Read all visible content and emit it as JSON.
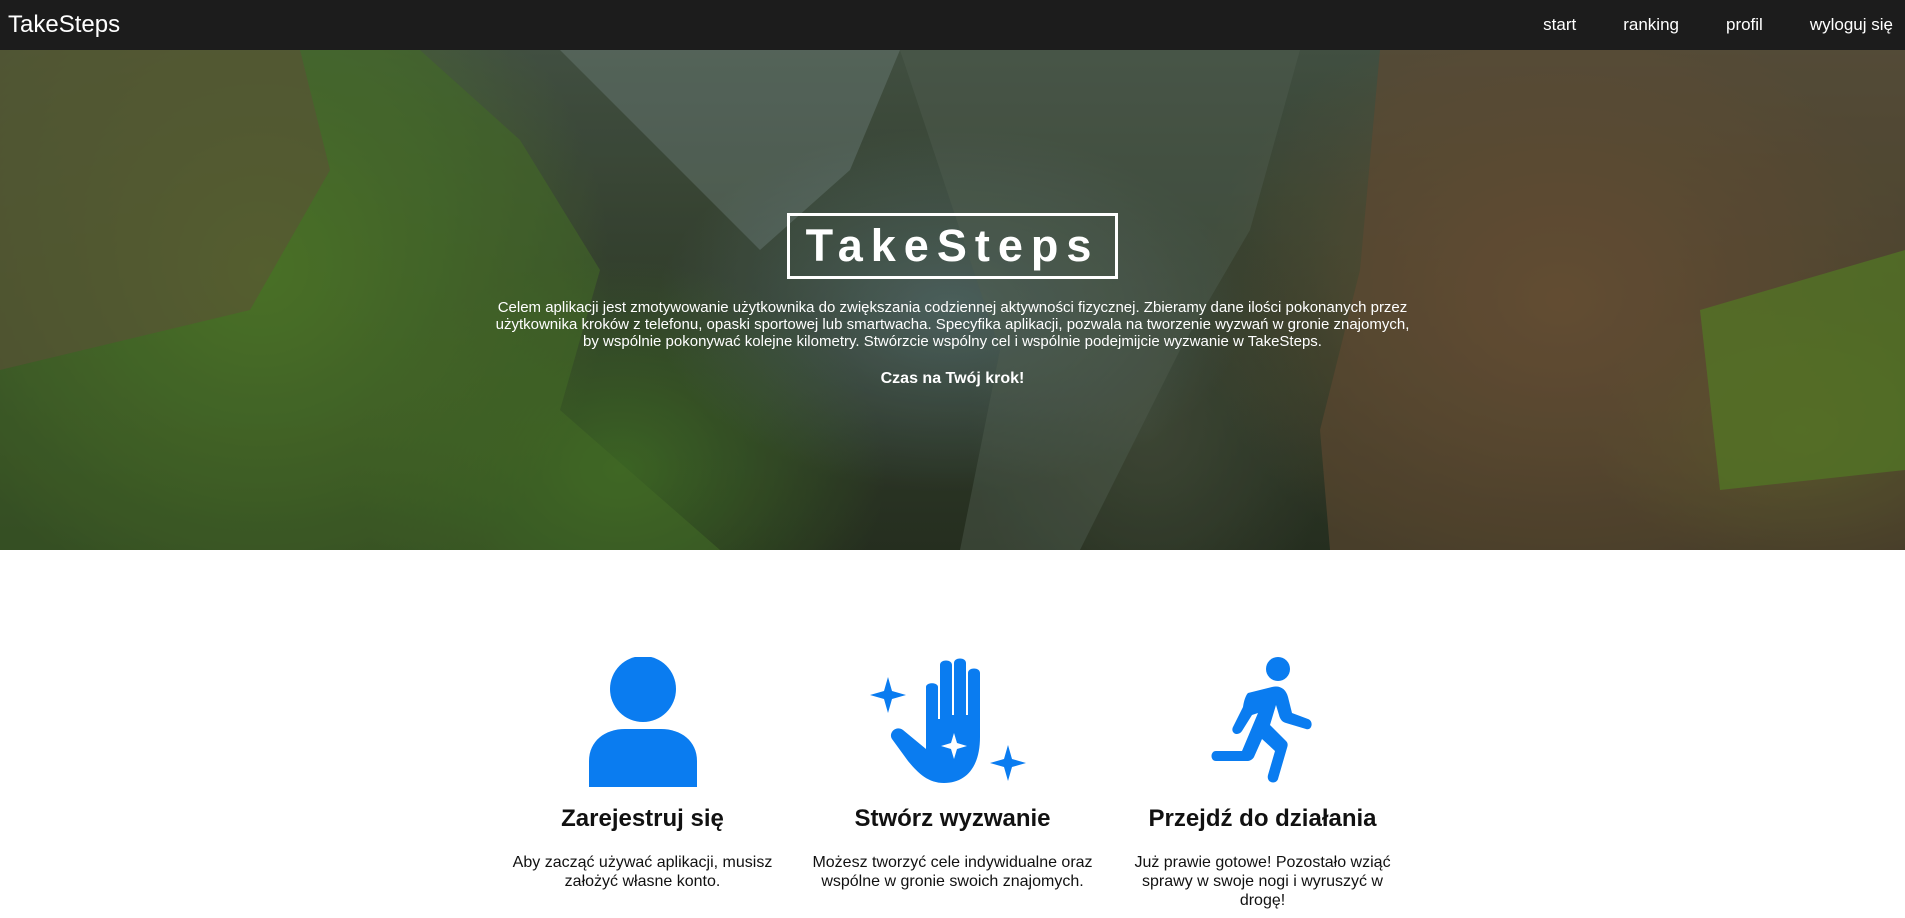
{
  "navbar": {
    "brand": "TakeSteps",
    "links": [
      {
        "label": "start"
      },
      {
        "label": "ranking"
      },
      {
        "label": "profil"
      },
      {
        "label": "wyloguj się"
      }
    ]
  },
  "hero": {
    "title": "TakeSteps",
    "description": "Celem aplikacji jest zmotywowanie użytkownika do zwiększania codziennej aktywności fizycznej. Zbieramy dane ilości pokonanych przez użytkownika kroków z telefonu, opaski sportowej lub smartwacha. Specyfika aplikacji, pozwala na tworzenie wyzwań w gronie znajomych, by wspólnie pokonywać kolejne kilometry. Stwórzcie wspólny cel i wspólnie podejmijcie wyzwanie w TakeSteps.",
    "cta": "Czas na Twój krok!"
  },
  "features": [
    {
      "icon": "user-icon",
      "title": "Zarejestruj się",
      "text": "Aby zacząć używać aplikacji, musisz założyć własne konto."
    },
    {
      "icon": "sparkle-hand-icon",
      "title": "Stwórz wyzwanie",
      "text": "Możesz tworzyć cele indywidualne oraz wspólne w gronie swoich znajomych."
    },
    {
      "icon": "running-person-icon",
      "title": "Przejdź do działania",
      "text": "Już prawie gotowe! Pozostało wziąć sprawy w swoje nogi i wyruszyć w drogę!"
    }
  ],
  "colors": {
    "navbar_bg": "#1c1c1c",
    "icon_blue": "#0a7cf0",
    "text_dark": "#111111"
  }
}
